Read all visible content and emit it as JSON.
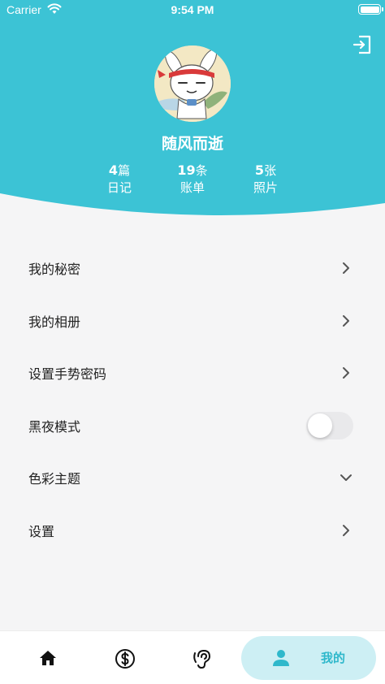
{
  "status_bar": {
    "carrier": "Carrier",
    "time": "9:54 PM"
  },
  "profile": {
    "username": "随风而逝",
    "avatar": "cartoon-rabbit-avatar"
  },
  "stats": [
    {
      "value": "4",
      "unit": "篇",
      "label": "日记"
    },
    {
      "value": "19",
      "unit": "条",
      "label": "账单"
    },
    {
      "value": "5",
      "unit": "张",
      "label": "照片"
    }
  ],
  "menu": [
    {
      "label": "我的秘密",
      "control": "chevron-right"
    },
    {
      "label": "我的相册",
      "control": "chevron-right"
    },
    {
      "label": "设置手势密码",
      "control": "chevron-right"
    },
    {
      "label": "黑夜模式",
      "control": "toggle",
      "enabled": false
    },
    {
      "label": "色彩主题",
      "control": "chevron-down"
    },
    {
      "label": "设置",
      "control": "chevron-right"
    }
  ],
  "tabbar": {
    "tabs": [
      {
        "icon": "home-icon"
      },
      {
        "icon": "dollar-icon"
      },
      {
        "icon": "ear-icon"
      },
      {
        "icon": "person-icon",
        "label": "我的",
        "active": true
      }
    ]
  },
  "colors": {
    "primary": "#3cc3d5",
    "active_tab_bg": "#cdeff4",
    "active_tab_text": "#2fb8cb"
  }
}
